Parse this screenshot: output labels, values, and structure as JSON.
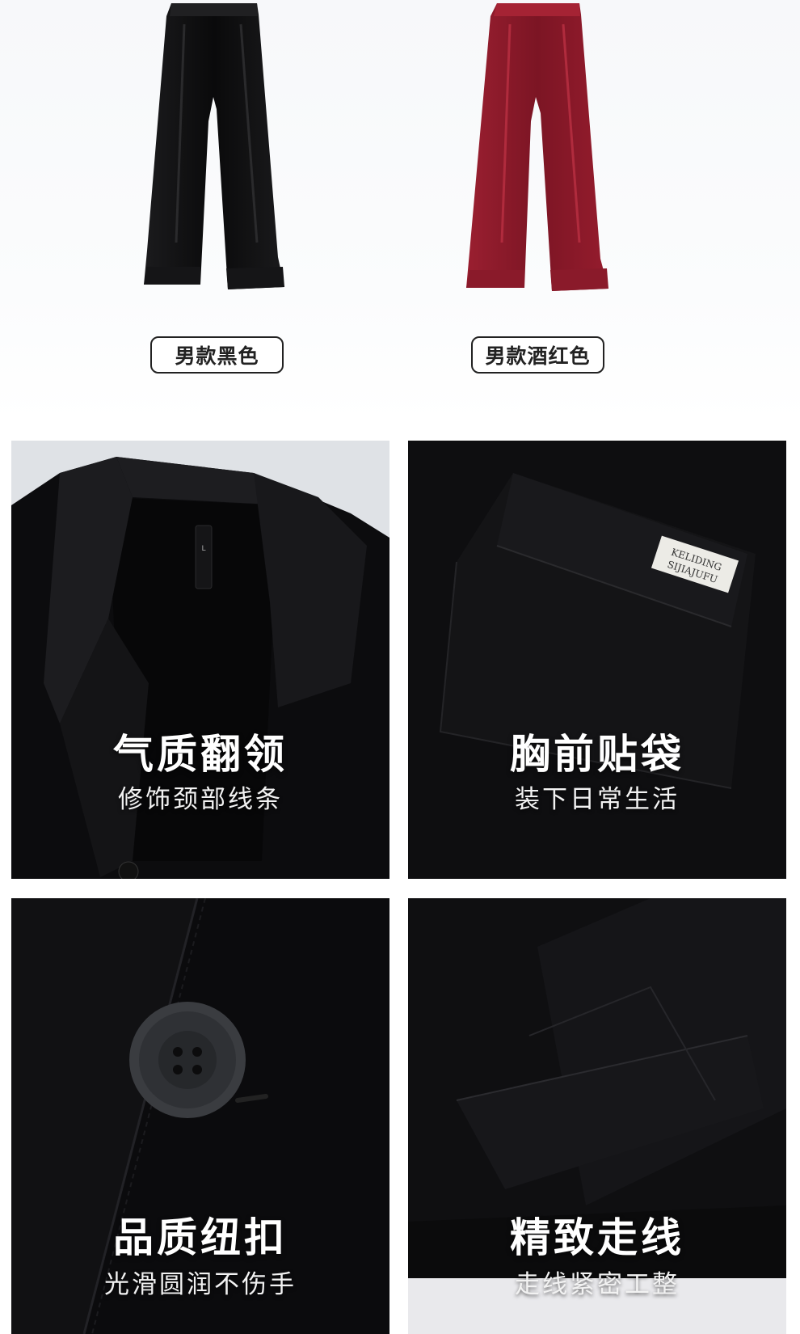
{
  "swatches": [
    {
      "label": "男款黑色",
      "color": "#111111"
    },
    {
      "label": "男款酒红色",
      "color": "#8e1a2b"
    }
  ],
  "features": [
    {
      "title": "气质翻领",
      "subtitle": "修饰颈部线条"
    },
    {
      "title": "胸前贴袋",
      "subtitle": "装下日常生活"
    },
    {
      "title": "品质纽扣",
      "subtitle": "光滑圆润不伤手"
    },
    {
      "title": "精致走线",
      "subtitle": "走线紧密工整"
    }
  ],
  "pocket_label": {
    "line1": "KELIDING",
    "line2": "SIJIAJUFU"
  },
  "collar_tag": {
    "size": "L"
  }
}
